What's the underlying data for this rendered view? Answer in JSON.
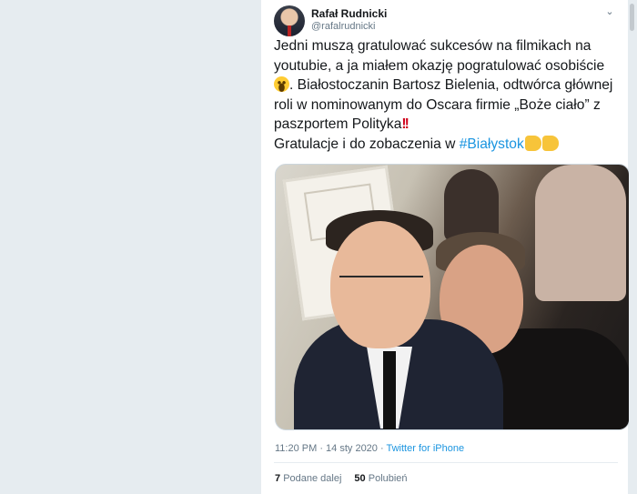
{
  "tweet": {
    "author_name": "Rafał Rudnicki",
    "author_handle": "@rafalrudnicki",
    "text_lines": [
      "Jedni muszą gratulować sukcesów na filmikach na",
      "youtubie, a ja miałem okazję pogratulować osobiście",
      ". Białostoczanin Bartosz Bielenia, odtwórca głównej",
      "roli w nominowanym do Oscara firmie „Boże ciało” z",
      "paszportem Polityka",
      "Gratulacje i do zobaczenia w "
    ],
    "hashtag": "#Białystok",
    "emoji_names": [
      "grinning-face-emoji",
      "double-exclamation-emoji",
      "thumbs-up-emoji",
      "clapping-hands-emoji"
    ],
    "exclamation": "!!",
    "timestamp": "11:20 PM · 14 sty 2020 · ",
    "client": "Twitter for iPhone",
    "retweets_count": "7",
    "retweets_label": "Podane dalej",
    "likes_count": "50",
    "likes_label": "Polubień"
  },
  "colors": {
    "link": "#1b95e0",
    "text": "#14171a",
    "secondary": "#657786",
    "background": "#e6ecf0"
  }
}
